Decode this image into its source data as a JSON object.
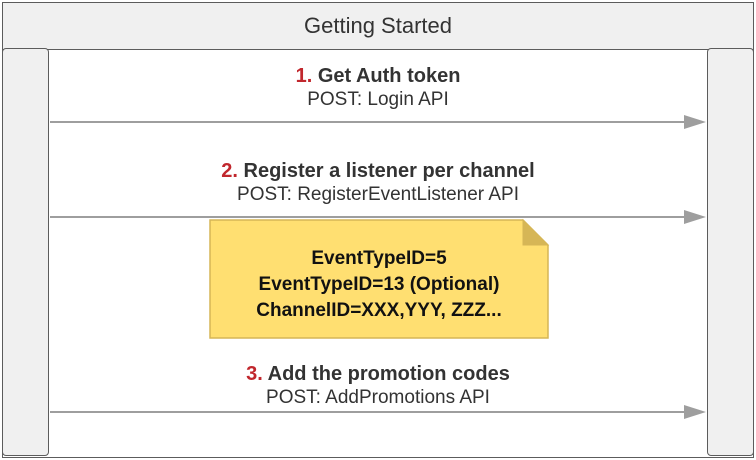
{
  "header": {
    "title": "Getting Started"
  },
  "steps": [
    {
      "number": "1.",
      "title": "Get Auth token",
      "subtitle": "POST: Login API"
    },
    {
      "number": "2.",
      "title": "Register a listener per channel",
      "subtitle": "POST: RegisterEventListener API"
    },
    {
      "number": "3.",
      "title": "Add the promotion codes",
      "subtitle": "POST: AddPromotions API"
    }
  ],
  "note": {
    "lines": [
      "EventTypeID=5",
      "EventTypeID=13 (Optional)",
      "ChannelID=XXX,YYY, ZZZ..."
    ]
  },
  "colors": {
    "step_number": "#c1272d",
    "note_fill": "#ffdf71",
    "note_border": "#d6b656",
    "arrow": "#9e9e9e",
    "lifeline_fill": "#f0f0f0"
  }
}
